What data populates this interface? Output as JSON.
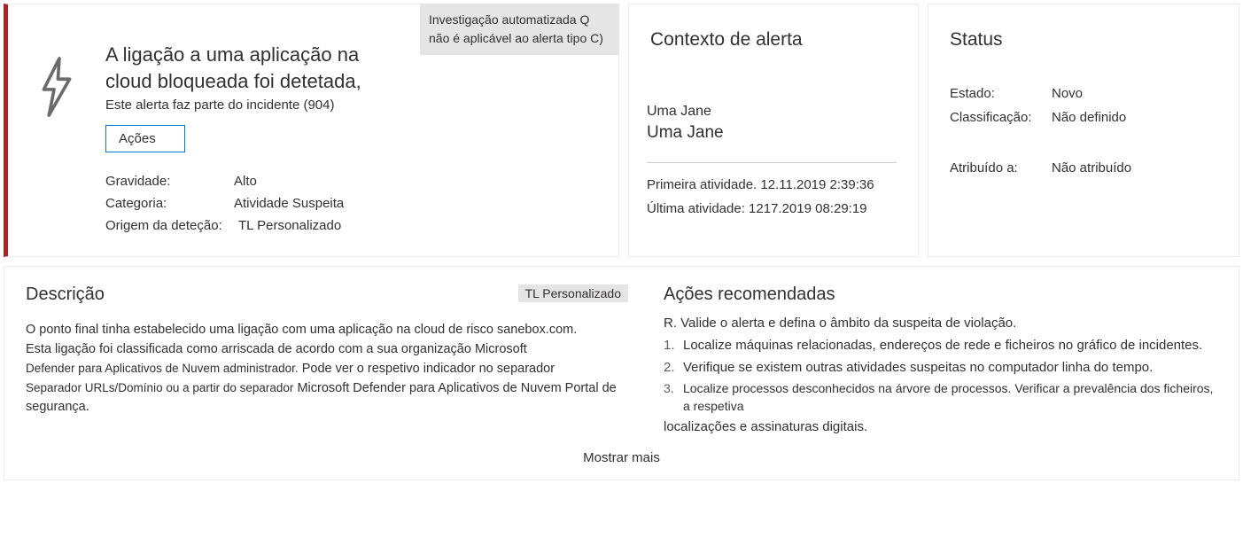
{
  "alert": {
    "title": "A ligação a uma aplicação na cloud bloqueada foi detetada,",
    "incident_line": "Este alerta faz parte do incidente (904)",
    "actions_label": "Ações",
    "severity_label": "Gravidade:",
    "severity_value": "Alto",
    "category_label": "Categoria:",
    "category_value": "Atividade Suspeita",
    "source_label": "Origem da deteção:",
    "source_value": "TL Personalizado",
    "investigation_note": "Investigação automatizada Q não é aplicável ao alerta tipo C)"
  },
  "context": {
    "title": "Contexto de alerta",
    "user_line1": "Uma Jane",
    "user_line2": "Uma Jane",
    "first_activity": "Primeira atividade. 12.11.2019 2:39:36",
    "last_activity": "Última atividade: 1217.2019 08:29:19"
  },
  "status": {
    "title": "Status",
    "state_label": "Estado:",
    "state_value": "Novo",
    "class_label": "Classificação:",
    "class_value": "Não definido",
    "assigned_label": "Atribuído a:",
    "assigned_value": "Não atribuído"
  },
  "description": {
    "title": "Descrição",
    "tag": "TL Personalizado",
    "line1": "O ponto final tinha estabelecido uma ligação com uma aplicação na cloud de risco sanebox.com.",
    "line2a": "Esta ligação foi classificada como arriscada de acordo com a sua organização Microsoft",
    "line2b": "Defender para Aplicativos de Nuvem administrador.",
    "line2c": "Pode ver o respetivo indicador no separador",
    "line3a": "Separador URLs/Domínio ou a partir do separador",
    "line3b": "Microsoft Defender para Aplicativos de Nuvem Portal de segurança."
  },
  "recommended": {
    "title": "Ações recomendadas",
    "intro": "R. Valide o alerta e defina o âmbito da suspeita de violação.",
    "item1": "Localize máquinas relacionadas, endereços de rede e ficheiros no gráfico de incidentes.",
    "item2": "Verifique se existem outras atividades suspeitas no computador linha do tempo.",
    "item3": "Localize processos desconhecidos na árvore de processos. Verificar a prevalência dos ficheiros, a respetiva",
    "item3_cont": "localizações e assinaturas digitais."
  },
  "footer": {
    "show_more": "Mostrar mais"
  }
}
